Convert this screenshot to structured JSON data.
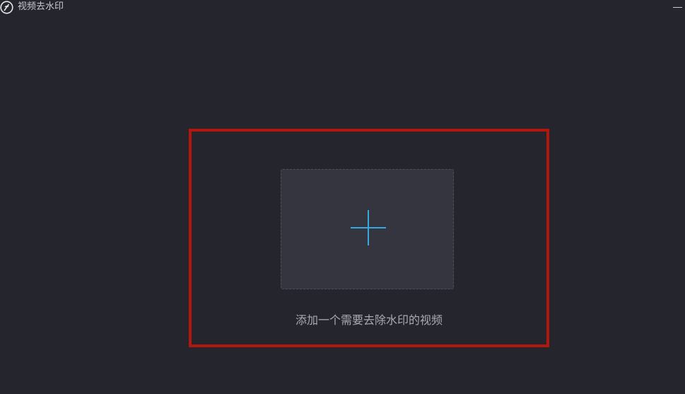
{
  "window": {
    "title": "视频去水印",
    "app_icon": "app-logo-icon",
    "minimize_icon": "minimize-icon"
  },
  "main": {
    "add_area_icon": "plus-icon",
    "add_hint": "添加一个需要去除水印的视频"
  },
  "colors": {
    "background": "#25252d",
    "drop_area": "#353540",
    "accent": "#37a7e0",
    "highlight_frame": "#b3160f"
  }
}
